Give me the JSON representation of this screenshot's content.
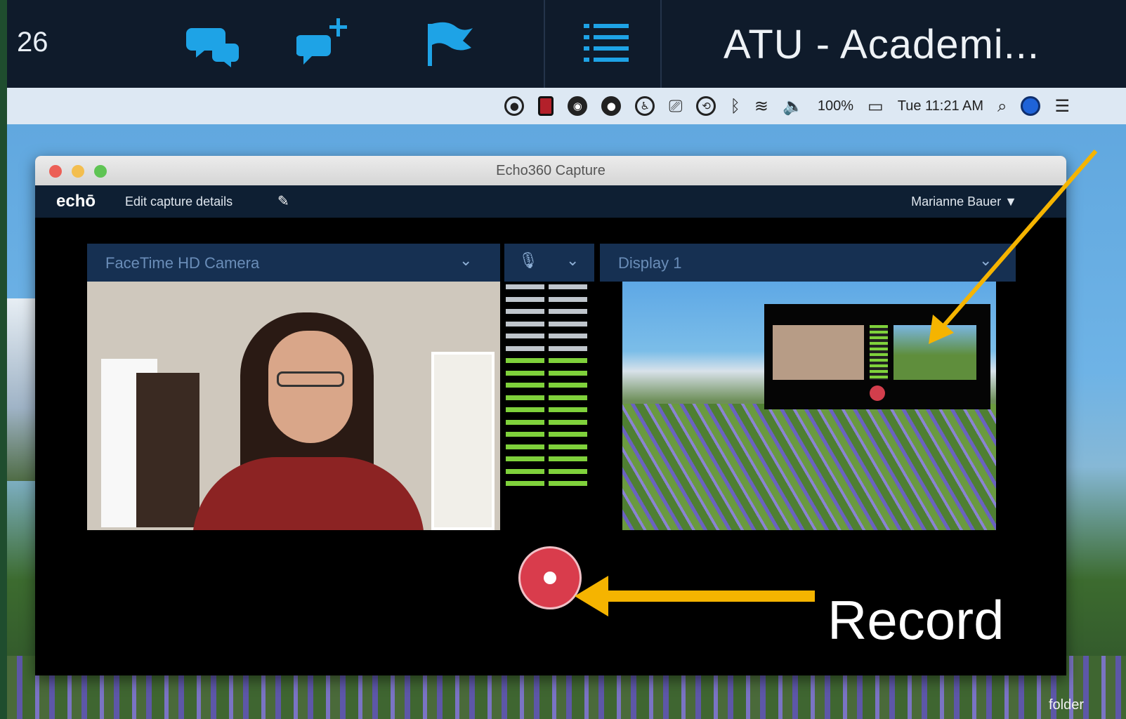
{
  "toolbar": {
    "date_fragment": "26",
    "title": "ATU - Academi...",
    "icons": [
      "conversations-icon",
      "new-chat-icon",
      "flag-icon",
      "list-icon"
    ]
  },
  "menubar": {
    "battery": "100%",
    "clock": "Tue 11:21 AM"
  },
  "window": {
    "title": "Echo360 Capture",
    "logo": "echō",
    "edit_link": "Edit capture details",
    "user": "Marianne Bauer ▼"
  },
  "sources": {
    "video": "FaceTime HD Camera",
    "display": "Display 1"
  },
  "audio_meter": {
    "segments_total": 17,
    "segments_active": 11
  },
  "annotation": {
    "record_label": "Record"
  },
  "desktop": {
    "folder_label": "folder"
  },
  "colors": {
    "record": "#d93c4c",
    "arrow": "#f5b400",
    "meter_active": "#7fd13b",
    "toolbar_icons": "#1ea3e6"
  }
}
